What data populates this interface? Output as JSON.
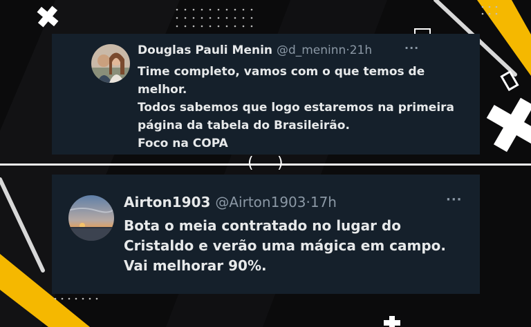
{
  "colors": {
    "tweet_bg": "#15202b",
    "text": "#e7e9ea",
    "secondary": "#8b98a5",
    "accent_yellow": "#f5b800",
    "divider": "#f2f2f2"
  },
  "divider": {
    "open": "(",
    "close": ")"
  },
  "tweets": [
    {
      "name": "Douglas Pauli Menin",
      "handle": "@d_meninn",
      "separator": "·",
      "time": "21h",
      "text": "Time completo, vamos com o que temos de melhor.\nTodos sabemos que logo estaremos na primeira página da tabela do Brasileirão.\nFoco na COPA",
      "more": "···",
      "avatar_icon": "couple-photo-avatar"
    },
    {
      "name": "Airton1903",
      "handle": "@Airton1903",
      "separator": "·",
      "time": "17h",
      "text": "Bota o meia contratado no lugar do Cristaldo e verão uma mágica em campo.\nVai melhorar 90%.",
      "more": "···",
      "avatar_icon": "sunset-photo-avatar"
    }
  ]
}
